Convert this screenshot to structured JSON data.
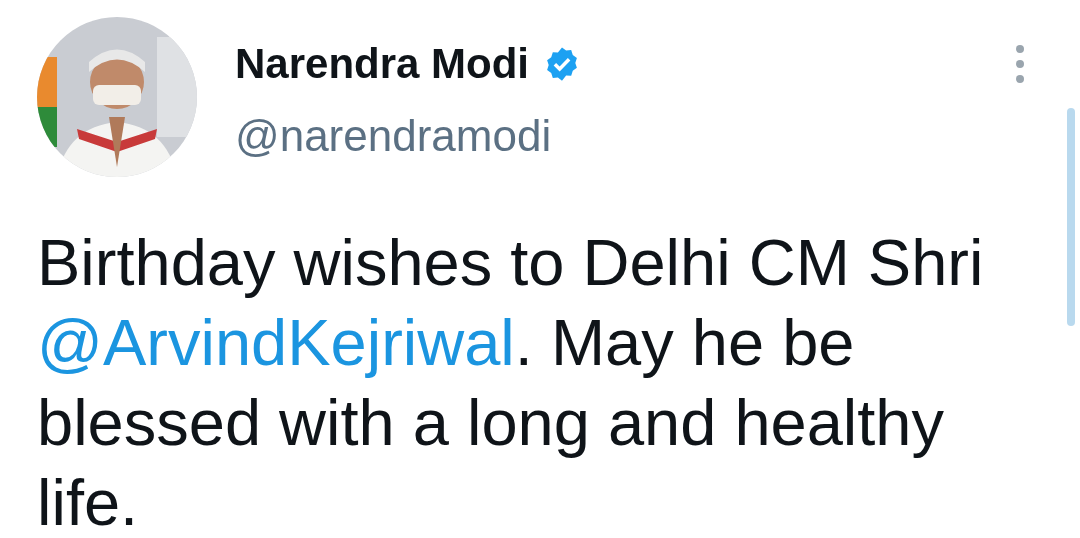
{
  "author": {
    "name": "Narendra Modi",
    "verified": true,
    "handle": "@narendramodi"
  },
  "tweet": {
    "parts": [
      {
        "kind": "text",
        "text": "Birthday wishes to Delhi CM Shri "
      },
      {
        "kind": "mention",
        "text": "@ArvindKejriwal"
      },
      {
        "kind": "text",
        "text": ". May he be blessed with a long and healthy life."
      }
    ]
  }
}
